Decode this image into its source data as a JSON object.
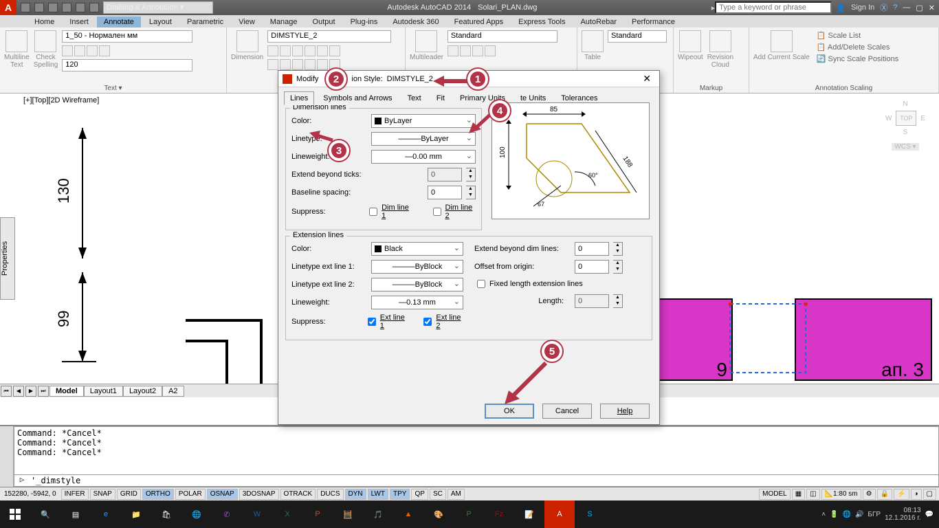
{
  "app": {
    "title": "Autodesk AutoCAD 2014",
    "file": "Solari_PLAN.dwg",
    "dropdown": "Drafting & Annotation",
    "search_placeholder": "Type a keyword or phrase",
    "signin": "Sign In"
  },
  "ribbon_tabs": [
    "Home",
    "Insert",
    "Annotate",
    "Layout",
    "Parametric",
    "View",
    "Manage",
    "Output",
    "Plug-ins",
    "Autodesk 360",
    "Featured Apps",
    "Express Tools",
    "AutoRebar",
    "Performance"
  ],
  "ribbon_active": 2,
  "ribbon": {
    "text": {
      "title": "Text ▾",
      "btn1": "Multiline\nText",
      "btn2": "Check\nSpelling",
      "style": "1_50 - Нормален мм",
      "height": "120"
    },
    "dim": {
      "title": "",
      "btn": "Dimension",
      "style": "DIMSTYLE_2"
    },
    "leader": {
      "btn": "Multileader",
      "style": "Standard"
    },
    "table": {
      "btn": "Table",
      "style": "Standard"
    },
    "markup": {
      "title": "Markup",
      "b1": "Wipeout",
      "b2": "Revision\nCloud"
    },
    "scale": {
      "title": "Annotation Scaling",
      "b": "Add Current Scale",
      "l1": "Scale List",
      "l2": "Add/Delete Scales",
      "l3": "Sync Scale Positions"
    }
  },
  "viewport": {
    "label": "[+][Top][2D Wireframe]",
    "vc": "TOP",
    "wcs": "WCS ▾",
    "d1": "130",
    "d2": "99",
    "m1": "9",
    "m2": "ап. 3"
  },
  "layout_tabs": [
    "Model",
    "Layout1",
    "Layout2",
    "A2"
  ],
  "cmd": {
    "hist": "Command: *Cancel*\nCommand: *Cancel*\nCommand: *Cancel*",
    "input": "'_dimstyle"
  },
  "status": {
    "coord": "152280, -5942, 0",
    "toggles": [
      "INFER",
      "SNAP",
      "GRID",
      "ORTHO",
      "POLAR",
      "OSNAP",
      "3DOSNAP",
      "OTRACK",
      "DUCS",
      "DYN",
      "LWT",
      "TPY",
      "QP",
      "SC",
      "AM"
    ],
    "toggles_on": [
      3,
      5,
      9,
      10,
      11
    ],
    "model": "MODEL",
    "scale": "1:80 sm",
    "lang": "БГР"
  },
  "dialog": {
    "title_prefix": "Modify",
    "title_mid": "ion Style:",
    "style": "DIMSTYLE_2",
    "tabs": [
      "Lines",
      "Symbols and Arrows",
      "Text",
      "Fit",
      "Primary Units",
      "te Units",
      "Tolerances"
    ],
    "tab_active": 0,
    "dim_lines": {
      "group": "Dimension lines",
      "color_l": "Color:",
      "color": "ByLayer",
      "lt_l": "Linetype:",
      "lt": "ByLayer",
      "lw_l": "Lineweight:",
      "lw": "0.00 mm",
      "ext_l": "Extend beyond ticks:",
      "ext": "0",
      "base_l": "Baseline spacing:",
      "base": "0",
      "sup_l": "Suppress:",
      "c1": "Dim line 1",
      "c2": "Dim line 2",
      "c1v": false,
      "c2v": false
    },
    "ext_lines": {
      "group": "Extension lines",
      "color_l": "Color:",
      "color": "Black",
      "l1_l": "Linetype ext line 1:",
      "l1": "ByBlock",
      "l2_l": "Linetype ext line 2:",
      "l2": "ByBlock",
      "lw_l": "Lineweight:",
      "lw": "0.13 mm",
      "sup_l": "Suppress:",
      "c1": "Ext line 1",
      "c2": "Ext line 2",
      "c1v": true,
      "c2v": true,
      "ebd_l": "Extend beyond dim lines:",
      "ebd": "0",
      "ofo_l": "Offset from origin:",
      "ofo": "0",
      "fix_l": "Fixed length extension lines",
      "len_l": "Length:",
      "len": "0"
    },
    "preview": {
      "d1": "85",
      "d2": "100",
      "d3": "188",
      "d4": "60°",
      "d5": "67"
    },
    "buttons": {
      "ok": "OK",
      "cancel": "Cancel",
      "help": "Help"
    }
  },
  "callouts": {
    "1": "1",
    "2": "2",
    "3": "3",
    "4": "4",
    "5": "5"
  },
  "taskbar": {
    "time": "08:13",
    "date": "12.1.2016 г."
  }
}
